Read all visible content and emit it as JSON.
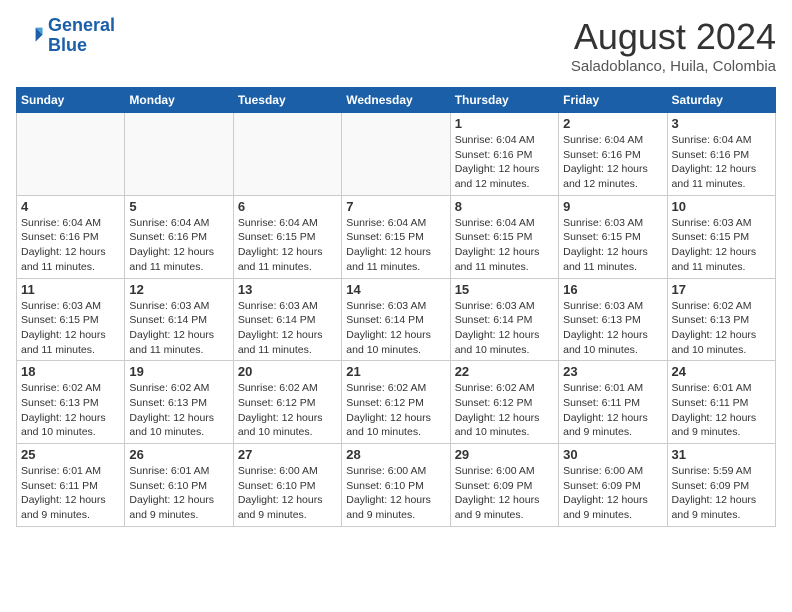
{
  "header": {
    "logo_line1": "General",
    "logo_line2": "Blue",
    "month": "August 2024",
    "location": "Saladoblanco, Huila, Colombia"
  },
  "weekdays": [
    "Sunday",
    "Monday",
    "Tuesday",
    "Wednesday",
    "Thursday",
    "Friday",
    "Saturday"
  ],
  "weeks": [
    [
      {
        "day": "",
        "info": ""
      },
      {
        "day": "",
        "info": ""
      },
      {
        "day": "",
        "info": ""
      },
      {
        "day": "",
        "info": ""
      },
      {
        "day": "1",
        "info": "Sunrise: 6:04 AM\nSunset: 6:16 PM\nDaylight: 12 hours\nand 12 minutes."
      },
      {
        "day": "2",
        "info": "Sunrise: 6:04 AM\nSunset: 6:16 PM\nDaylight: 12 hours\nand 12 minutes."
      },
      {
        "day": "3",
        "info": "Sunrise: 6:04 AM\nSunset: 6:16 PM\nDaylight: 12 hours\nand 11 minutes."
      }
    ],
    [
      {
        "day": "4",
        "info": "Sunrise: 6:04 AM\nSunset: 6:16 PM\nDaylight: 12 hours\nand 11 minutes."
      },
      {
        "day": "5",
        "info": "Sunrise: 6:04 AM\nSunset: 6:16 PM\nDaylight: 12 hours\nand 11 minutes."
      },
      {
        "day": "6",
        "info": "Sunrise: 6:04 AM\nSunset: 6:15 PM\nDaylight: 12 hours\nand 11 minutes."
      },
      {
        "day": "7",
        "info": "Sunrise: 6:04 AM\nSunset: 6:15 PM\nDaylight: 12 hours\nand 11 minutes."
      },
      {
        "day": "8",
        "info": "Sunrise: 6:04 AM\nSunset: 6:15 PM\nDaylight: 12 hours\nand 11 minutes."
      },
      {
        "day": "9",
        "info": "Sunrise: 6:03 AM\nSunset: 6:15 PM\nDaylight: 12 hours\nand 11 minutes."
      },
      {
        "day": "10",
        "info": "Sunrise: 6:03 AM\nSunset: 6:15 PM\nDaylight: 12 hours\nand 11 minutes."
      }
    ],
    [
      {
        "day": "11",
        "info": "Sunrise: 6:03 AM\nSunset: 6:15 PM\nDaylight: 12 hours\nand 11 minutes."
      },
      {
        "day": "12",
        "info": "Sunrise: 6:03 AM\nSunset: 6:14 PM\nDaylight: 12 hours\nand 11 minutes."
      },
      {
        "day": "13",
        "info": "Sunrise: 6:03 AM\nSunset: 6:14 PM\nDaylight: 12 hours\nand 11 minutes."
      },
      {
        "day": "14",
        "info": "Sunrise: 6:03 AM\nSunset: 6:14 PM\nDaylight: 12 hours\nand 10 minutes."
      },
      {
        "day": "15",
        "info": "Sunrise: 6:03 AM\nSunset: 6:14 PM\nDaylight: 12 hours\nand 10 minutes."
      },
      {
        "day": "16",
        "info": "Sunrise: 6:03 AM\nSunset: 6:13 PM\nDaylight: 12 hours\nand 10 minutes."
      },
      {
        "day": "17",
        "info": "Sunrise: 6:02 AM\nSunset: 6:13 PM\nDaylight: 12 hours\nand 10 minutes."
      }
    ],
    [
      {
        "day": "18",
        "info": "Sunrise: 6:02 AM\nSunset: 6:13 PM\nDaylight: 12 hours\nand 10 minutes."
      },
      {
        "day": "19",
        "info": "Sunrise: 6:02 AM\nSunset: 6:13 PM\nDaylight: 12 hours\nand 10 minutes."
      },
      {
        "day": "20",
        "info": "Sunrise: 6:02 AM\nSunset: 6:12 PM\nDaylight: 12 hours\nand 10 minutes."
      },
      {
        "day": "21",
        "info": "Sunrise: 6:02 AM\nSunset: 6:12 PM\nDaylight: 12 hours\nand 10 minutes."
      },
      {
        "day": "22",
        "info": "Sunrise: 6:02 AM\nSunset: 6:12 PM\nDaylight: 12 hours\nand 10 minutes."
      },
      {
        "day": "23",
        "info": "Sunrise: 6:01 AM\nSunset: 6:11 PM\nDaylight: 12 hours\nand 9 minutes."
      },
      {
        "day": "24",
        "info": "Sunrise: 6:01 AM\nSunset: 6:11 PM\nDaylight: 12 hours\nand 9 minutes."
      }
    ],
    [
      {
        "day": "25",
        "info": "Sunrise: 6:01 AM\nSunset: 6:11 PM\nDaylight: 12 hours\nand 9 minutes."
      },
      {
        "day": "26",
        "info": "Sunrise: 6:01 AM\nSunset: 6:10 PM\nDaylight: 12 hours\nand 9 minutes."
      },
      {
        "day": "27",
        "info": "Sunrise: 6:00 AM\nSunset: 6:10 PM\nDaylight: 12 hours\nand 9 minutes."
      },
      {
        "day": "28",
        "info": "Sunrise: 6:00 AM\nSunset: 6:10 PM\nDaylight: 12 hours\nand 9 minutes."
      },
      {
        "day": "29",
        "info": "Sunrise: 6:00 AM\nSunset: 6:09 PM\nDaylight: 12 hours\nand 9 minutes."
      },
      {
        "day": "30",
        "info": "Sunrise: 6:00 AM\nSunset: 6:09 PM\nDaylight: 12 hours\nand 9 minutes."
      },
      {
        "day": "31",
        "info": "Sunrise: 5:59 AM\nSunset: 6:09 PM\nDaylight: 12 hours\nand 9 minutes."
      }
    ]
  ]
}
